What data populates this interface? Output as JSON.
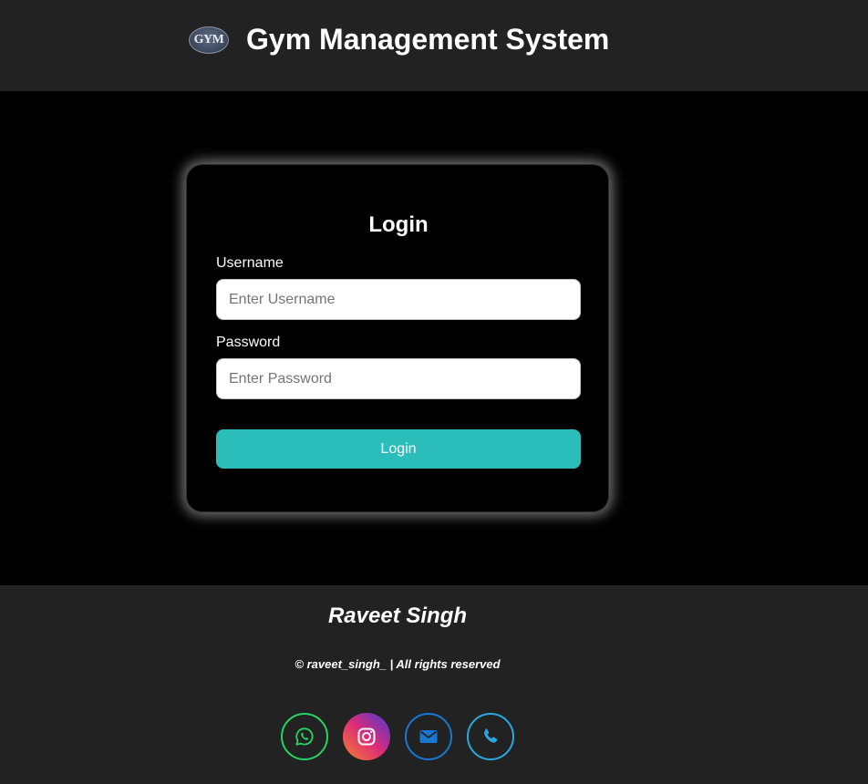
{
  "header": {
    "logo_text": "GYM",
    "title": "Gym Management System"
  },
  "login": {
    "title": "Login",
    "username_label": "Username",
    "username_placeholder": "Enter Username",
    "username_value": "",
    "password_label": "Password",
    "password_placeholder": "Enter Password",
    "password_value": "",
    "submit_label": "Login"
  },
  "footer": {
    "name": "Raveet Singh",
    "copyright": "© raveet_singh_ | All rights reserved",
    "social": [
      {
        "icon": "whatsapp-icon",
        "color": "#25d366"
      },
      {
        "icon": "instagram-icon",
        "color": "#dd2a7b"
      },
      {
        "icon": "mail-icon",
        "color": "#1877d2"
      },
      {
        "icon": "phone-icon",
        "color": "#29a8e0"
      }
    ]
  },
  "colors": {
    "background": "#000000",
    "header_footer": "#222222",
    "accent": "#2bbdb9"
  }
}
